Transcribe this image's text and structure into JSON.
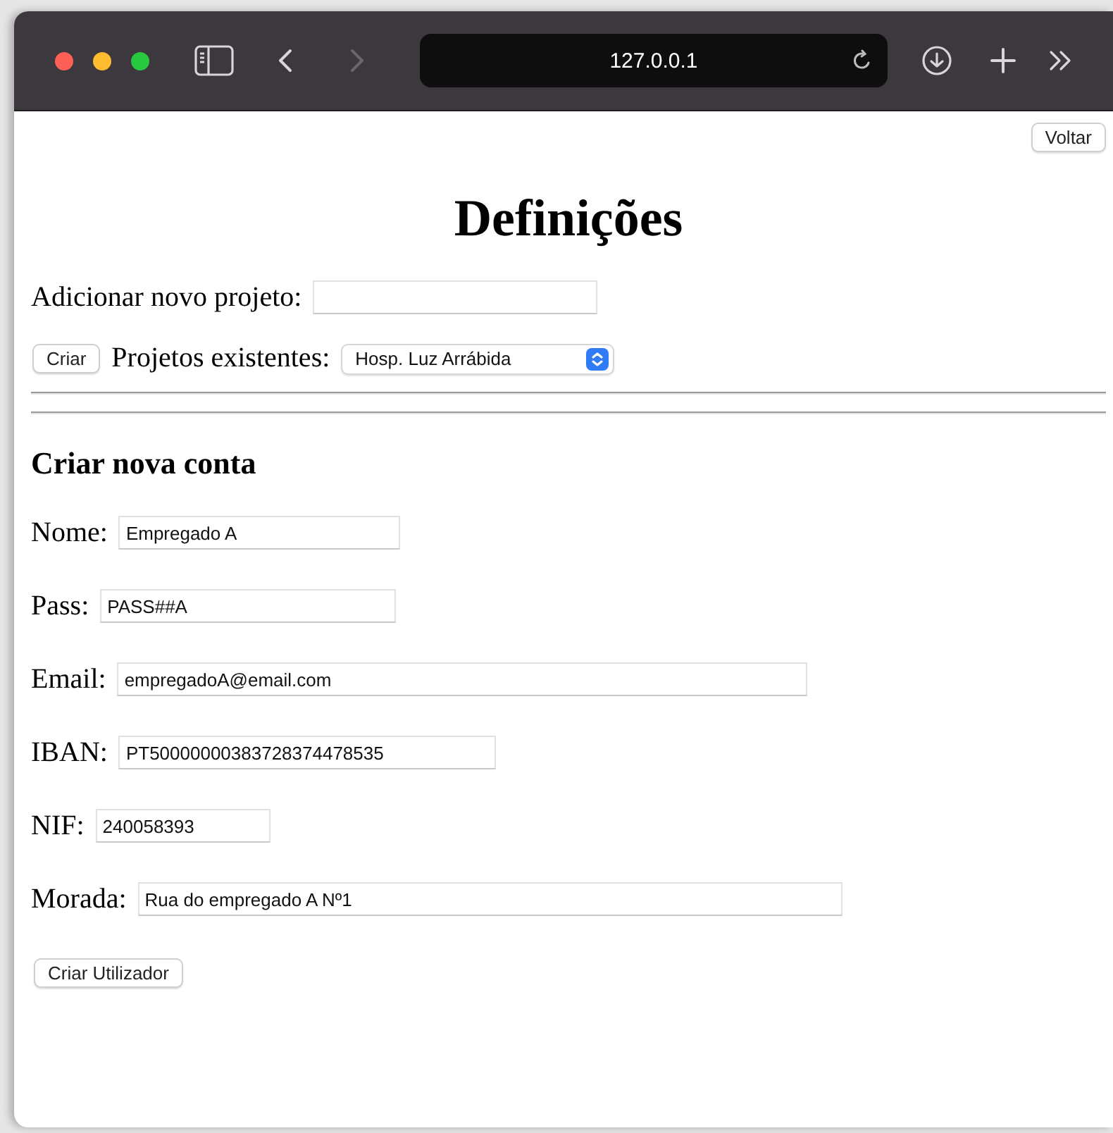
{
  "browser": {
    "url": "127.0.0.1",
    "nav": [
      {
        "kind": "back",
        "disabled": false
      },
      {
        "kind": "forward",
        "disabled": true
      }
    ]
  },
  "page": {
    "back_button": "Voltar",
    "title": "Definições",
    "new_project": {
      "label": "Adicionar novo projeto:"
    },
    "create_button": "Criar",
    "existing_projects": {
      "label": "Projetos existentes:",
      "value": "Hosp. Luz Arrábida"
    },
    "account": {
      "heading": "Criar nova conta",
      "fields": [
        {
          "label": "Nome:",
          "value": "Empregado A"
        },
        {
          "label": "Pass:",
          "value": "PASS##A"
        },
        {
          "label": "Email:",
          "value": "empregadoA@email.com"
        },
        {
          "label": "IBAN:",
          "value": "PT50000000383728374478535"
        },
        {
          "label": "NIF:",
          "value": "240058393"
        },
        {
          "label": "Morada:",
          "value": "Rua do empregado A Nº1"
        }
      ],
      "submit": "Criar Utilizador"
    }
  }
}
